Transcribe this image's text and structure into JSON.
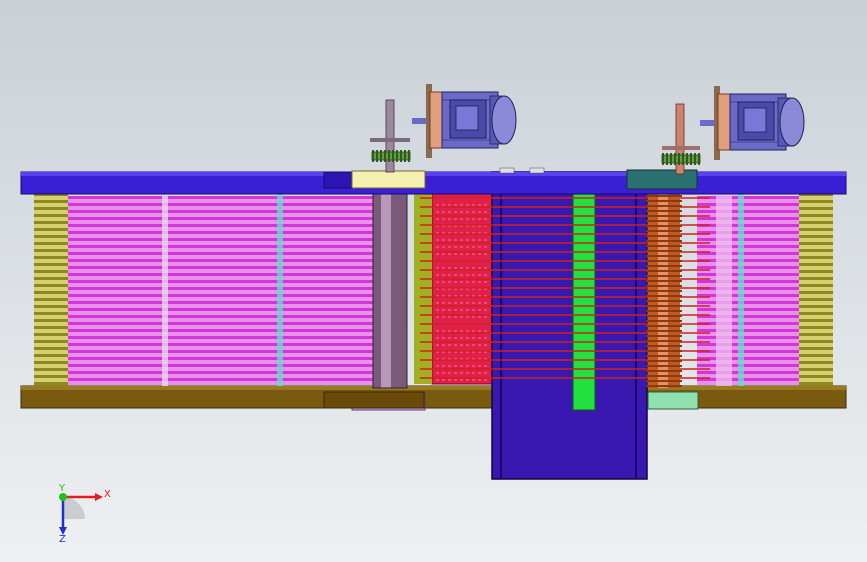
{
  "viewport": {
    "name": "cad-graphics-area",
    "background_top": "#c9d0d6",
    "background_bottom": "#eef0f2"
  },
  "model": {
    "colors": {
      "top_plate": "#3b1fd6",
      "base_plate": "#7a5a0e",
      "magenta_lines": "#d236d8",
      "stack_red": "#e0204a",
      "center_column": "#3818b0",
      "green_bar": "#22e040",
      "copper_shaft": "#d06a30",
      "motor_body": "#6a6ac8",
      "motor_flange": "#e0a080",
      "yellow_block": "#f6f0b0",
      "lilac_block": "#d8a0f0",
      "teal_block": "#2a7070",
      "mint_block": "#90e0b0",
      "spring_coils": "#b8b040"
    }
  },
  "triad": {
    "x_label": "X",
    "y_label": "Y",
    "z_label": "Z",
    "x_color": "#e02020",
    "y_color": "#20c020",
    "z_color": "#2030d0"
  }
}
